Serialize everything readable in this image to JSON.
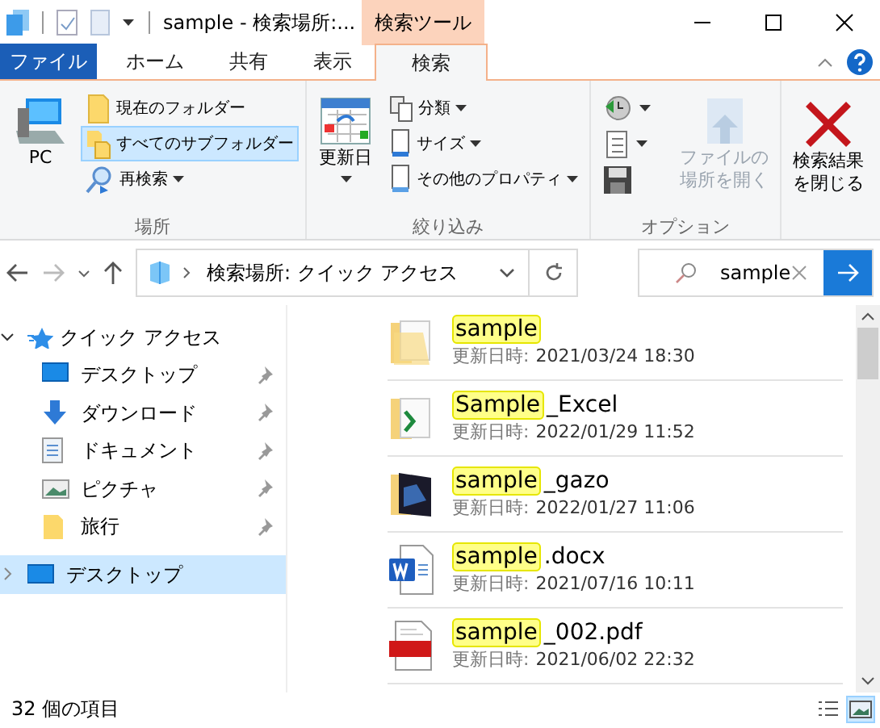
{
  "window": {
    "title": "sample - 検索場所:...",
    "context_tab": "検索ツール"
  },
  "tabs": [
    {
      "label": "ファイル",
      "kind": "file",
      "selected": false
    },
    {
      "label": "ホーム",
      "kind": "tab",
      "selected": false
    },
    {
      "label": "共有",
      "kind": "tab",
      "selected": false
    },
    {
      "label": "表示",
      "kind": "tab",
      "selected": false
    },
    {
      "label": "検索",
      "kind": "tab",
      "selected": true
    }
  ],
  "ribbon": [
    {
      "label": "場所",
      "items": [
        {
          "kind": "large",
          "label": "PC",
          "dropdown": false,
          "selected": false,
          "disabled": false
        },
        {
          "kind": "small",
          "label": "現在のフォルダー",
          "dropdown": false,
          "selected": false,
          "disabled": false
        },
        {
          "kind": "small",
          "label": "すべてのサブフォルダー",
          "dropdown": false,
          "selected": true,
          "disabled": false
        },
        {
          "kind": "small",
          "label": "再検索",
          "dropdown": true,
          "selected": false,
          "disabled": false
        }
      ]
    },
    {
      "label": "絞り込み",
      "items": [
        {
          "kind": "large",
          "label": "更新日",
          "dropdown": true,
          "selected": false,
          "disabled": false
        },
        {
          "kind": "small",
          "label": "分類",
          "dropdown": true,
          "selected": false,
          "disabled": false
        },
        {
          "kind": "small",
          "label": "サイズ",
          "dropdown": true,
          "selected": false,
          "disabled": false
        },
        {
          "kind": "small",
          "label": "その他のプロパティ",
          "dropdown": true,
          "selected": false,
          "disabled": false
        }
      ]
    },
    {
      "label": "オプション",
      "items": [
        {
          "kind": "icon",
          "dropdown": true,
          "selected": false,
          "disabled": false
        },
        {
          "kind": "icon",
          "dropdown": true,
          "selected": false,
          "disabled": false
        },
        {
          "kind": "icon",
          "dropdown": false,
          "selected": false,
          "disabled": false
        },
        {
          "kind": "large",
          "label_lines": [
            "ファイルの",
            "場所を開く"
          ],
          "dropdown": false,
          "selected": false,
          "disabled": true
        }
      ]
    },
    {
      "items": [
        {
          "kind": "large",
          "label_lines": [
            "検索結果",
            "を閉じる"
          ],
          "dropdown": false,
          "selected": false,
          "disabled": false
        }
      ]
    }
  ],
  "address": {
    "path": "検索場所: クイック アクセス"
  },
  "search": {
    "value": "sample"
  },
  "nav": [
    {
      "label": "クイック アクセス",
      "expanded": true,
      "selected": false,
      "children": [
        {
          "label": "デスクトップ",
          "pinned": true
        },
        {
          "label": "ダウンロード",
          "pinned": true
        },
        {
          "label": "ドキュメント",
          "pinned": true
        },
        {
          "label": "ピクチャ",
          "pinned": true
        },
        {
          "label": "旅行",
          "pinned": true
        }
      ]
    },
    {
      "label": "デスクトップ",
      "expanded": false,
      "selected": true
    }
  ],
  "files": [
    {
      "kind": "folder",
      "match": "sample",
      "modified_label": "更新日時:",
      "modified": "2021/03/24 18:30"
    },
    {
      "kind": "excel-folder",
      "match": "Sample",
      "rest": "_Excel",
      "modified_label": "更新日時:",
      "modified": "2022/01/29 11:52"
    },
    {
      "kind": "image-folder",
      "match": "sample",
      "rest": "_gazo",
      "modified_label": "更新日時:",
      "modified": "2022/01/27 11:06"
    },
    {
      "kind": "word",
      "match": "sample",
      "rest": ".docx",
      "modified_label": "更新日時:",
      "modified": "2021/07/16 10:11"
    },
    {
      "kind": "pdf",
      "match": "sample",
      "rest": "_002.pdf",
      "modified_label": "更新日時:",
      "modified": "2021/06/02 22:32"
    }
  ],
  "status_bar": {
    "count": "32 個の項目"
  },
  "view_buttons": [
    {
      "selected": false
    },
    {
      "selected": true
    }
  ]
}
